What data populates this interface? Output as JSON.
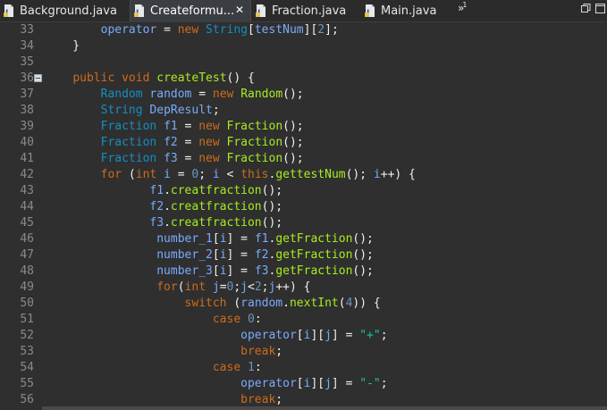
{
  "tabs": [
    {
      "label": "Background.java",
      "active": false
    },
    {
      "label": "Createformu...",
      "active": true
    },
    {
      "label": "Fraction.java",
      "active": false
    },
    {
      "label": "Main.java",
      "active": false
    }
  ],
  "overflow": {
    "symbol": "»",
    "count": "1"
  },
  "lines": [
    {
      "n": "33",
      "fold": false,
      "tokens": [
        [
          "pl",
          "        "
        ],
        [
          "va",
          "operator"
        ],
        [
          "pl",
          " = "
        ],
        [
          "kw",
          "new"
        ],
        [
          "pl",
          " "
        ],
        [
          "ty",
          "String"
        ],
        [
          "pl",
          "["
        ],
        [
          "va",
          "testNum"
        ],
        [
          "pl",
          "]["
        ],
        [
          "nu",
          "2"
        ],
        [
          "pl",
          "];"
        ]
      ]
    },
    {
      "n": "34",
      "fold": false,
      "tokens": [
        [
          "pl",
          "    }"
        ]
      ]
    },
    {
      "n": "35",
      "fold": false,
      "tokens": []
    },
    {
      "n": "36",
      "fold": true,
      "tokens": [
        [
          "pl",
          "    "
        ],
        [
          "kw",
          "public"
        ],
        [
          "pl",
          " "
        ],
        [
          "kw",
          "void"
        ],
        [
          "pl",
          " "
        ],
        [
          "me",
          "createTest"
        ],
        [
          "pl",
          "() {"
        ]
      ]
    },
    {
      "n": "37",
      "fold": false,
      "tokens": [
        [
          "pl",
          "        "
        ],
        [
          "ty",
          "Random"
        ],
        [
          "pl",
          " "
        ],
        [
          "va",
          "random"
        ],
        [
          "pl",
          " = "
        ],
        [
          "kw",
          "new"
        ],
        [
          "pl",
          " "
        ],
        [
          "me",
          "Random"
        ],
        [
          "pl",
          "();"
        ]
      ]
    },
    {
      "n": "38",
      "fold": false,
      "tokens": [
        [
          "pl",
          "        "
        ],
        [
          "ty",
          "String"
        ],
        [
          "pl",
          " "
        ],
        [
          "va",
          "DepResult"
        ],
        [
          "pl",
          ";"
        ]
      ]
    },
    {
      "n": "39",
      "fold": false,
      "tokens": [
        [
          "pl",
          "        "
        ],
        [
          "ty",
          "Fraction"
        ],
        [
          "pl",
          " "
        ],
        [
          "va",
          "f1"
        ],
        [
          "pl",
          " = "
        ],
        [
          "kw",
          "new"
        ],
        [
          "pl",
          " "
        ],
        [
          "me",
          "Fraction"
        ],
        [
          "pl",
          "();"
        ]
      ]
    },
    {
      "n": "40",
      "fold": false,
      "tokens": [
        [
          "pl",
          "        "
        ],
        [
          "ty",
          "Fraction"
        ],
        [
          "pl",
          " "
        ],
        [
          "va",
          "f2"
        ],
        [
          "pl",
          " = "
        ],
        [
          "kw",
          "new"
        ],
        [
          "pl",
          " "
        ],
        [
          "me",
          "Fraction"
        ],
        [
          "pl",
          "();"
        ]
      ]
    },
    {
      "n": "41",
      "fold": false,
      "tokens": [
        [
          "pl",
          "        "
        ],
        [
          "ty",
          "Fraction"
        ],
        [
          "pl",
          " "
        ],
        [
          "va",
          "f3"
        ],
        [
          "pl",
          " = "
        ],
        [
          "kw",
          "new"
        ],
        [
          "pl",
          " "
        ],
        [
          "me",
          "Fraction"
        ],
        [
          "pl",
          "();"
        ]
      ]
    },
    {
      "n": "42",
      "fold": false,
      "tokens": [
        [
          "pl",
          "        "
        ],
        [
          "kw",
          "for"
        ],
        [
          "pl",
          " ("
        ],
        [
          "kw",
          "int"
        ],
        [
          "pl",
          " "
        ],
        [
          "va",
          "i"
        ],
        [
          "pl",
          " = "
        ],
        [
          "nu",
          "0"
        ],
        [
          "pl",
          "; "
        ],
        [
          "va",
          "i"
        ],
        [
          "pl",
          " < "
        ],
        [
          "kw",
          "this"
        ],
        [
          "pl",
          "."
        ],
        [
          "me",
          "gettestNum"
        ],
        [
          "pl",
          "(); "
        ],
        [
          "va",
          "i"
        ],
        [
          "pl",
          "++) {"
        ]
      ]
    },
    {
      "n": "43",
      "fold": false,
      "tokens": [
        [
          "pl",
          "               "
        ],
        [
          "va",
          "f1"
        ],
        [
          "pl",
          "."
        ],
        [
          "me",
          "creatfraction"
        ],
        [
          "pl",
          "();"
        ]
      ]
    },
    {
      "n": "44",
      "fold": false,
      "tokens": [
        [
          "pl",
          "               "
        ],
        [
          "va",
          "f2"
        ],
        [
          "pl",
          "."
        ],
        [
          "me",
          "creatfraction"
        ],
        [
          "pl",
          "();"
        ]
      ]
    },
    {
      "n": "45",
      "fold": false,
      "tokens": [
        [
          "pl",
          "               "
        ],
        [
          "va",
          "f3"
        ],
        [
          "pl",
          "."
        ],
        [
          "me",
          "creatfraction"
        ],
        [
          "pl",
          "();"
        ]
      ]
    },
    {
      "n": "46",
      "fold": false,
      "tokens": [
        [
          "pl",
          "                "
        ],
        [
          "va",
          "number_1"
        ],
        [
          "pl",
          "["
        ],
        [
          "va",
          "i"
        ],
        [
          "pl",
          "] = "
        ],
        [
          "va",
          "f1"
        ],
        [
          "pl",
          "."
        ],
        [
          "me",
          "getFraction"
        ],
        [
          "pl",
          "();"
        ]
      ]
    },
    {
      "n": "47",
      "fold": false,
      "tokens": [
        [
          "pl",
          "                "
        ],
        [
          "va",
          "number_2"
        ],
        [
          "pl",
          "["
        ],
        [
          "va",
          "i"
        ],
        [
          "pl",
          "] = "
        ],
        [
          "va",
          "f2"
        ],
        [
          "pl",
          "."
        ],
        [
          "me",
          "getFraction"
        ],
        [
          "pl",
          "();"
        ]
      ]
    },
    {
      "n": "48",
      "fold": false,
      "tokens": [
        [
          "pl",
          "                "
        ],
        [
          "va",
          "number_3"
        ],
        [
          "pl",
          "["
        ],
        [
          "va",
          "i"
        ],
        [
          "pl",
          "] = "
        ],
        [
          "va",
          "f3"
        ],
        [
          "pl",
          "."
        ],
        [
          "me",
          "getFraction"
        ],
        [
          "pl",
          "();"
        ]
      ]
    },
    {
      "n": "49",
      "fold": false,
      "tokens": [
        [
          "pl",
          "                "
        ],
        [
          "kw",
          "for"
        ],
        [
          "pl",
          "("
        ],
        [
          "kw",
          "int"
        ],
        [
          "pl",
          " "
        ],
        [
          "va",
          "j"
        ],
        [
          "pl",
          "="
        ],
        [
          "nu",
          "0"
        ],
        [
          "pl",
          ";"
        ],
        [
          "va",
          "j"
        ],
        [
          "pl",
          "<"
        ],
        [
          "nu",
          "2"
        ],
        [
          "pl",
          ";"
        ],
        [
          "va",
          "j"
        ],
        [
          "pl",
          "++) {"
        ]
      ]
    },
    {
      "n": "50",
      "fold": false,
      "tokens": [
        [
          "pl",
          "                    "
        ],
        [
          "kw",
          "switch"
        ],
        [
          "pl",
          " ("
        ],
        [
          "va",
          "random"
        ],
        [
          "pl",
          "."
        ],
        [
          "me",
          "nextInt"
        ],
        [
          "pl",
          "("
        ],
        [
          "nu",
          "4"
        ],
        [
          "pl",
          ")) {"
        ]
      ]
    },
    {
      "n": "51",
      "fold": false,
      "tokens": [
        [
          "pl",
          "                        "
        ],
        [
          "kw",
          "case"
        ],
        [
          "pl",
          " "
        ],
        [
          "nu",
          "0"
        ],
        [
          "pl",
          ":"
        ]
      ]
    },
    {
      "n": "52",
      "fold": false,
      "tokens": [
        [
          "pl",
          "                            "
        ],
        [
          "va",
          "operator"
        ],
        [
          "pl",
          "["
        ],
        [
          "va",
          "i"
        ],
        [
          "pl",
          "]["
        ],
        [
          "va",
          "j"
        ],
        [
          "pl",
          "] = "
        ],
        [
          "st",
          "\"+\""
        ],
        [
          "pl",
          ";"
        ]
      ]
    },
    {
      "n": "53",
      "fold": false,
      "tokens": [
        [
          "pl",
          "                            "
        ],
        [
          "kw",
          "break"
        ],
        [
          "pl",
          ";"
        ]
      ]
    },
    {
      "n": "54",
      "fold": false,
      "tokens": [
        [
          "pl",
          "                        "
        ],
        [
          "kw",
          "case"
        ],
        [
          "pl",
          " "
        ],
        [
          "nu",
          "1"
        ],
        [
          "pl",
          ":"
        ]
      ]
    },
    {
      "n": "55",
      "fold": false,
      "tokens": [
        [
          "pl",
          "                            "
        ],
        [
          "va",
          "operator"
        ],
        [
          "pl",
          "["
        ],
        [
          "va",
          "i"
        ],
        [
          "pl",
          "]["
        ],
        [
          "va",
          "j"
        ],
        [
          "pl",
          "] = "
        ],
        [
          "st",
          "\"-\""
        ],
        [
          "pl",
          ";"
        ]
      ]
    },
    {
      "n": "56",
      "fold": false,
      "tokens": [
        [
          "pl",
          "                            "
        ],
        [
          "kw",
          "break"
        ],
        [
          "pl",
          ";"
        ]
      ]
    }
  ],
  "colors": {
    "background": "#2f2f2f",
    "keyword": "#cc6c1d",
    "type": "#1290c3",
    "variable": "#79abff",
    "method": "#a7ec21",
    "string": "#17c6a3",
    "number": "#6897bb",
    "plain": "#f0f0f0",
    "line_number": "#8a8a8a"
  },
  "icons": {
    "tab_file": "java-file-icon",
    "close": "close-icon",
    "window_restore": "restore-icon",
    "window_maximize": "maximize-icon"
  }
}
